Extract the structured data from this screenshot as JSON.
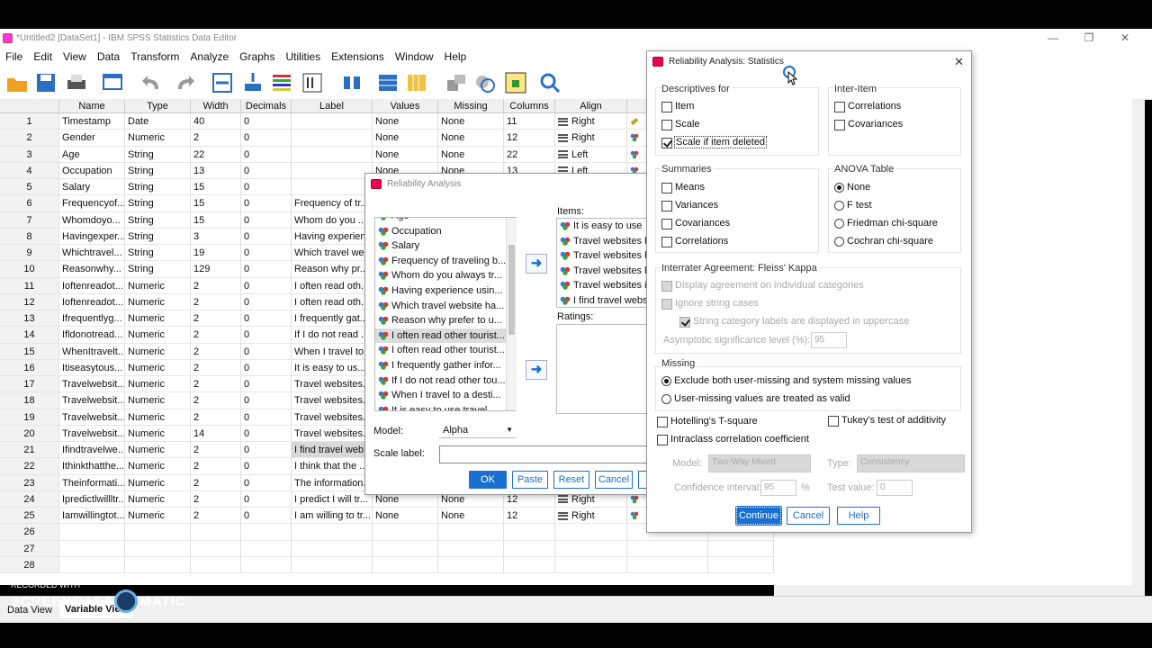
{
  "window": {
    "title": "*Untitled2 [DataSet1] - IBM SPSS Statistics Data Editor"
  },
  "menu": [
    "File",
    "Edit",
    "View",
    "Data",
    "Transform",
    "Analyze",
    "Graphs",
    "Utilities",
    "Extensions",
    "Window",
    "Help"
  ],
  "grid": {
    "headers": [
      "",
      "Name",
      "Type",
      "Width",
      "Decimals",
      "Label",
      "Values",
      "Missing",
      "Columns",
      "Align"
    ],
    "rows": [
      {
        "n": "1",
        "name": "Timestamp",
        "type": "Date",
        "width": "40",
        "dec": "0",
        "label": "",
        "values": "None",
        "missing": "None",
        "columns": "11",
        "align": "Right"
      },
      {
        "n": "2",
        "name": "Gender",
        "type": "Numeric",
        "width": "2",
        "dec": "0",
        "label": "",
        "values": "None",
        "missing": "None",
        "columns": "12",
        "align": "Right"
      },
      {
        "n": "3",
        "name": "Age",
        "type": "String",
        "width": "22",
        "dec": "0",
        "label": "",
        "values": "None",
        "missing": "None",
        "columns": "22",
        "align": "Left"
      },
      {
        "n": "4",
        "name": "Occupation",
        "type": "String",
        "width": "13",
        "dec": "0",
        "label": "",
        "values": "None",
        "missing": "None",
        "columns": "13",
        "align": "Left"
      },
      {
        "n": "5",
        "name": "Salary",
        "type": "String",
        "width": "15",
        "dec": "0",
        "label": "",
        "values": "",
        "missing": "",
        "columns": "",
        "align": ""
      },
      {
        "n": "6",
        "name": "Frequencyof...",
        "type": "String",
        "width": "15",
        "dec": "0",
        "label": "Frequency of tr...",
        "values": "",
        "missing": "",
        "columns": "",
        "align": ""
      },
      {
        "n": "7",
        "name": "Whomdoyo...",
        "type": "String",
        "width": "15",
        "dec": "0",
        "label": "Whom do you ...",
        "values": "",
        "missing": "",
        "columns": "",
        "align": ""
      },
      {
        "n": "8",
        "name": "Havingexper...",
        "type": "String",
        "width": "3",
        "dec": "0",
        "label": "Having experien...",
        "values": "",
        "missing": "",
        "columns": "",
        "align": ""
      },
      {
        "n": "9",
        "name": "Whichtravel...",
        "type": "String",
        "width": "19",
        "dec": "0",
        "label": "Which travel we...",
        "values": "",
        "missing": "",
        "columns": "",
        "align": ""
      },
      {
        "n": "10",
        "name": "Reasonwhy...",
        "type": "String",
        "width": "129",
        "dec": "0",
        "label": "Reason why pr...",
        "values": "",
        "missing": "",
        "columns": "",
        "align": ""
      },
      {
        "n": "11",
        "name": "Ioftenreadot...",
        "type": "Numeric",
        "width": "2",
        "dec": "0",
        "label": "I often read oth...",
        "values": "",
        "missing": "",
        "columns": "",
        "align": ""
      },
      {
        "n": "12",
        "name": "Ioftenreadot...",
        "type": "Numeric",
        "width": "2",
        "dec": "0",
        "label": "I often read oth...",
        "values": "",
        "missing": "",
        "columns": "",
        "align": ""
      },
      {
        "n": "13",
        "name": "Ifrequentlyg...",
        "type": "Numeric",
        "width": "2",
        "dec": "0",
        "label": "I frequently gat...",
        "values": "",
        "missing": "",
        "columns": "",
        "align": ""
      },
      {
        "n": "14",
        "name": "Ifldonotread...",
        "type": "Numeric",
        "width": "2",
        "dec": "0",
        "label": "If I do not read ...",
        "values": "",
        "missing": "",
        "columns": "",
        "align": ""
      },
      {
        "n": "15",
        "name": "WhenItravelt...",
        "type": "Numeric",
        "width": "2",
        "dec": "0",
        "label": "When I travel to...",
        "values": "",
        "missing": "",
        "columns": "",
        "align": ""
      },
      {
        "n": "16",
        "name": "Itiseasytous...",
        "type": "Numeric",
        "width": "2",
        "dec": "0",
        "label": "It is easy to us...",
        "values": "",
        "missing": "",
        "columns": "",
        "align": ""
      },
      {
        "n": "17",
        "name": "Travelwebsit...",
        "type": "Numeric",
        "width": "2",
        "dec": "0",
        "label": "Travel websites...",
        "values": "",
        "missing": "",
        "columns": "",
        "align": ""
      },
      {
        "n": "18",
        "name": "Travelwebsit...",
        "type": "Numeric",
        "width": "2",
        "dec": "0",
        "label": "Travel websites...",
        "values": "",
        "missing": "",
        "columns": "",
        "align": ""
      },
      {
        "n": "19",
        "name": "Travelwebsit...",
        "type": "Numeric",
        "width": "2",
        "dec": "0",
        "label": "Travel websites...",
        "values": "",
        "missing": "",
        "columns": "",
        "align": ""
      },
      {
        "n": "20",
        "name": "Travelwebsit...",
        "type": "Numeric",
        "width": "14",
        "dec": "0",
        "label": "Travel websites...",
        "values": "",
        "missing": "",
        "columns": "",
        "align": ""
      },
      {
        "n": "21",
        "name": "Ifindtravelwe...",
        "type": "Numeric",
        "width": "2",
        "dec": "0",
        "label": "I find travel web...",
        "values": "",
        "missing": "",
        "columns": "",
        "align": ""
      },
      {
        "n": "22",
        "name": "Ithinkthatthe...",
        "type": "Numeric",
        "width": "2",
        "dec": "0",
        "label": "I think that the ...",
        "values": "",
        "missing": "",
        "columns": "",
        "align": ""
      },
      {
        "n": "23",
        "name": "Theinformati...",
        "type": "Numeric",
        "width": "2",
        "dec": "0",
        "label": "The information...",
        "values": "",
        "missing": "",
        "columns": "",
        "align": ""
      },
      {
        "n": "24",
        "name": "Ipredictlwillltr...",
        "type": "Numeric",
        "width": "2",
        "dec": "0",
        "label": "I predict I will tr...",
        "values": "None",
        "missing": "None",
        "columns": "12",
        "align": "Right"
      },
      {
        "n": "25",
        "name": "Iamwillingtot...",
        "type": "Numeric",
        "width": "2",
        "dec": "0",
        "label": "I am willing to tr...",
        "values": "None",
        "missing": "None",
        "columns": "12",
        "align": "Right"
      },
      {
        "n": "26",
        "name": "",
        "type": "",
        "width": "",
        "dec": "",
        "label": "",
        "values": "",
        "missing": "",
        "columns": "",
        "align": ""
      },
      {
        "n": "27",
        "name": "",
        "type": "",
        "width": "",
        "dec": "",
        "label": "",
        "values": "",
        "missing": "",
        "columns": "",
        "align": ""
      },
      {
        "n": "28",
        "name": "",
        "type": "",
        "width": "",
        "dec": "",
        "label": "",
        "values": "",
        "missing": "",
        "columns": "",
        "align": ""
      }
    ]
  },
  "tabs": {
    "data_view": "Data View",
    "variable_view": "Variable View"
  },
  "reliability": {
    "title": "Reliability Analysis",
    "variables": [
      "Age",
      "Occupation",
      "Salary",
      "Frequency of traveling b...",
      "Whom do you always tr...",
      "Having experience usin...",
      "Which travel website ha...",
      "Reason why prefer to u...",
      "I often read other tourist...",
      "I often read other tourist...",
      "I frequently gather infor...",
      "If I do not read other tou...",
      "When I travel to a desti...",
      "It is easy to use travel..."
    ],
    "items_label": "Items:",
    "items": [
      "It is easy to use",
      "Travel websites h",
      "Travel websites h",
      "Travel websites h",
      "Travel websites i",
      "I find travel webs"
    ],
    "ratings_label": "Ratings:",
    "model_label": "Model:",
    "model_value": "Alpha",
    "scale_label": "Scale label:",
    "buttons": {
      "ok": "OK",
      "paste": "Paste",
      "reset": "Reset",
      "cancel": "Cancel"
    }
  },
  "stats": {
    "title": "Reliability Analysis: Statistics",
    "descriptives_title": "Descriptives for",
    "item": "Item",
    "scale": "Scale",
    "scale_if_deleted": "Scale if item deleted",
    "inter_item_title": "Inter-Item",
    "correlations": "Correlations",
    "covariances": "Covariances",
    "summaries_title": "Summaries",
    "means": "Means",
    "variances": "Variances",
    "s_covariances": "Covariances",
    "s_correlations": "Correlations",
    "anova_title": "ANOVA Table",
    "none": "None",
    "ftest": "F test",
    "friedman": "Friedman chi-square",
    "cochran": "Cochran chi-square",
    "fleiss_title": "Interrater Agreement: Fleiss' Kappa",
    "display_agreement": "Display agreement on individual categories",
    "ignore_string": "Ignore string cases",
    "string_upper": "String category labels are displayed in uppercase",
    "asymptotic": "Asymptotic significance level (%):",
    "asymptotic_value": "95",
    "missing_title": "Missing",
    "exclude_both": "Exclude both user-missing and system missing values",
    "user_missing_valid": "User-missing values are treated as valid",
    "hotelling": "Hotelling's T-square",
    "tukey": "Tukey's test of additivity",
    "intraclass": "Intraclass correlation coefficient",
    "model_label": "Model:",
    "model_value": "Two-Way Mixed",
    "type_label": "Type:",
    "type_value": "Consistency",
    "ci_label": "Confidence interval:",
    "ci_value": "95",
    "ci_unit": "%",
    "test_value_label": "Test value:",
    "test_value": "0",
    "continue": "Continue",
    "cancel": "Cancel",
    "help": "Help"
  },
  "watermark": {
    "line1": "RECORDED WITH",
    "line2": "SCREENCAST",
    "line3": "MATIC"
  }
}
